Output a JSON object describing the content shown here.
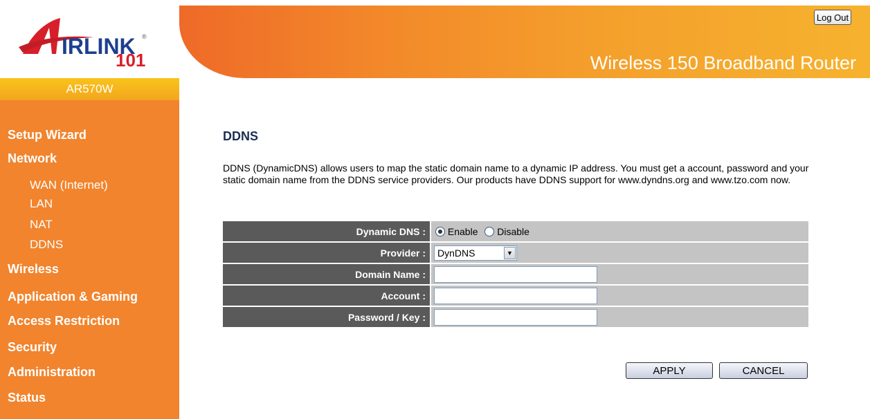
{
  "brand": {
    "logo_text": "AIRLINK 101",
    "model": "AR570W",
    "product_title": "Wireless 150 Broadband Router"
  },
  "header": {
    "logout_label": "Log Out"
  },
  "sidebar": {
    "items": [
      {
        "label": "Setup Wizard",
        "type": "main"
      },
      {
        "label": "Network",
        "type": "main"
      },
      {
        "label": "WAN (Internet)",
        "type": "sub"
      },
      {
        "label": "LAN",
        "type": "sub"
      },
      {
        "label": "NAT",
        "type": "sub"
      },
      {
        "label": "DDNS",
        "type": "sub",
        "active": true
      },
      {
        "label": "Wireless",
        "type": "main"
      },
      {
        "label": "Application & Gaming",
        "type": "main"
      },
      {
        "label": "Access Restriction",
        "type": "main"
      },
      {
        "label": "Security",
        "type": "main"
      },
      {
        "label": "Administration",
        "type": "main"
      },
      {
        "label": "Status",
        "type": "main"
      }
    ]
  },
  "main": {
    "title": "DDNS",
    "description": "DDNS (DynamicDNS) allows users to map the static domain name to a dynamic IP address. You must get a account, password and your static domain name from the DDNS service providers. Our products have DDNS support for www.dyndns.org and www.tzo.com now.",
    "form": {
      "dynamic_dns_label": "Dynamic DNS :",
      "enable_label": "Enable",
      "disable_label": "Disable",
      "selected": "Enable",
      "provider_label": "Provider :",
      "provider_value": "DynDNS",
      "domain_label": "Domain Name :",
      "domain_value": "",
      "account_label": "Account :",
      "account_value": "",
      "password_label": "Password / Key :",
      "password_value": ""
    },
    "apply_label": "APPLY",
    "cancel_label": "CANCEL"
  },
  "colors": {
    "sidebar_bg": "#f1842d",
    "model_bar": "#f5b01f",
    "label_cell": "#5a5a5a",
    "value_cell": "#c4c4c4",
    "title_text": "#1a2e55"
  },
  "icons": [
    "airlink-logo",
    "radio-selected",
    "radio-unselected",
    "dropdown-arrow-icon"
  ]
}
